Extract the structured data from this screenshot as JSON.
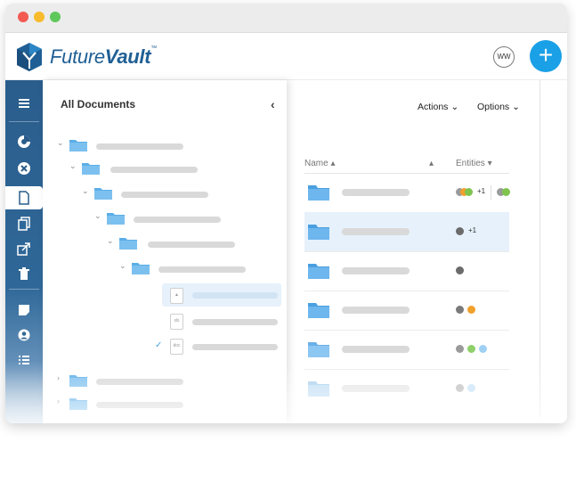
{
  "app": {
    "brand_light": "Future",
    "brand_bold": "Vault",
    "brand_tm": "™",
    "brand_color": "#1f5f95",
    "user_initials": "WW",
    "add_button": "+",
    "accent": "#1aa0e6"
  },
  "sidebar": {
    "items": [
      {
        "icon": "menu-icon"
      },
      {
        "icon": "dashboard-icon"
      },
      {
        "icon": "close-circle-icon"
      },
      {
        "icon": "document-icon",
        "active": true
      },
      {
        "icon": "copy-icon"
      },
      {
        "icon": "share-icon"
      },
      {
        "icon": "trash-icon"
      },
      {
        "icon": "note-icon"
      },
      {
        "icon": "user-icon"
      },
      {
        "icon": "list-icon"
      }
    ]
  },
  "panel": {
    "title": "All Documents",
    "collapse_icon": "‹"
  },
  "toolbar": {
    "actions_label": "Actions",
    "options_label": "Options"
  },
  "table": {
    "columns": [
      "Name",
      "Entities"
    ],
    "rows": [
      {
        "extra": "+1",
        "selected": false
      },
      {
        "extra": "+1",
        "selected": true
      },
      {
        "extra": "",
        "selected": false
      },
      {
        "extra": "",
        "selected": false
      },
      {
        "extra": "",
        "selected": false
      },
      {
        "extra": "",
        "selected": false
      }
    ]
  }
}
